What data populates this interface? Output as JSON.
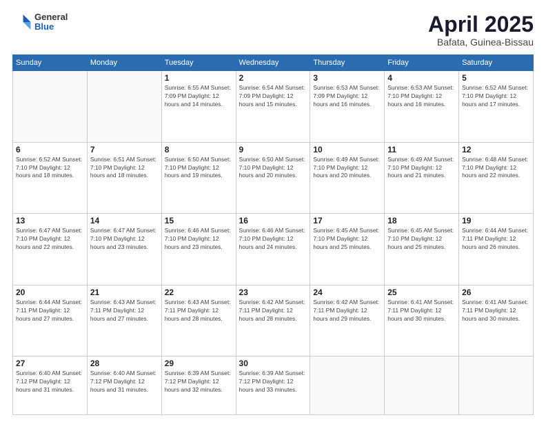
{
  "header": {
    "logo_general": "General",
    "logo_blue": "Blue",
    "month_title": "April 2025",
    "subtitle": "Bafata, Guinea-Bissau"
  },
  "weekdays": [
    "Sunday",
    "Monday",
    "Tuesday",
    "Wednesday",
    "Thursday",
    "Friday",
    "Saturday"
  ],
  "weeks": [
    [
      {
        "day": "",
        "info": ""
      },
      {
        "day": "",
        "info": ""
      },
      {
        "day": "1",
        "info": "Sunrise: 6:55 AM\nSunset: 7:09 PM\nDaylight: 12 hours and 14 minutes."
      },
      {
        "day": "2",
        "info": "Sunrise: 6:54 AM\nSunset: 7:09 PM\nDaylight: 12 hours and 15 minutes."
      },
      {
        "day": "3",
        "info": "Sunrise: 6:53 AM\nSunset: 7:09 PM\nDaylight: 12 hours and 16 minutes."
      },
      {
        "day": "4",
        "info": "Sunrise: 6:53 AM\nSunset: 7:10 PM\nDaylight: 12 hours and 16 minutes."
      },
      {
        "day": "5",
        "info": "Sunrise: 6:52 AM\nSunset: 7:10 PM\nDaylight: 12 hours and 17 minutes."
      }
    ],
    [
      {
        "day": "6",
        "info": "Sunrise: 6:52 AM\nSunset: 7:10 PM\nDaylight: 12 hours and 18 minutes."
      },
      {
        "day": "7",
        "info": "Sunrise: 6:51 AM\nSunset: 7:10 PM\nDaylight: 12 hours and 18 minutes."
      },
      {
        "day": "8",
        "info": "Sunrise: 6:50 AM\nSunset: 7:10 PM\nDaylight: 12 hours and 19 minutes."
      },
      {
        "day": "9",
        "info": "Sunrise: 6:50 AM\nSunset: 7:10 PM\nDaylight: 12 hours and 20 minutes."
      },
      {
        "day": "10",
        "info": "Sunrise: 6:49 AM\nSunset: 7:10 PM\nDaylight: 12 hours and 20 minutes."
      },
      {
        "day": "11",
        "info": "Sunrise: 6:49 AM\nSunset: 7:10 PM\nDaylight: 12 hours and 21 minutes."
      },
      {
        "day": "12",
        "info": "Sunrise: 6:48 AM\nSunset: 7:10 PM\nDaylight: 12 hours and 22 minutes."
      }
    ],
    [
      {
        "day": "13",
        "info": "Sunrise: 6:47 AM\nSunset: 7:10 PM\nDaylight: 12 hours and 22 minutes."
      },
      {
        "day": "14",
        "info": "Sunrise: 6:47 AM\nSunset: 7:10 PM\nDaylight: 12 hours and 23 minutes."
      },
      {
        "day": "15",
        "info": "Sunrise: 6:46 AM\nSunset: 7:10 PM\nDaylight: 12 hours and 23 minutes."
      },
      {
        "day": "16",
        "info": "Sunrise: 6:46 AM\nSunset: 7:10 PM\nDaylight: 12 hours and 24 minutes."
      },
      {
        "day": "17",
        "info": "Sunrise: 6:45 AM\nSunset: 7:10 PM\nDaylight: 12 hours and 25 minutes."
      },
      {
        "day": "18",
        "info": "Sunrise: 6:45 AM\nSunset: 7:10 PM\nDaylight: 12 hours and 25 minutes."
      },
      {
        "day": "19",
        "info": "Sunrise: 6:44 AM\nSunset: 7:11 PM\nDaylight: 12 hours and 26 minutes."
      }
    ],
    [
      {
        "day": "20",
        "info": "Sunrise: 6:44 AM\nSunset: 7:11 PM\nDaylight: 12 hours and 27 minutes."
      },
      {
        "day": "21",
        "info": "Sunrise: 6:43 AM\nSunset: 7:11 PM\nDaylight: 12 hours and 27 minutes."
      },
      {
        "day": "22",
        "info": "Sunrise: 6:43 AM\nSunset: 7:11 PM\nDaylight: 12 hours and 28 minutes."
      },
      {
        "day": "23",
        "info": "Sunrise: 6:42 AM\nSunset: 7:11 PM\nDaylight: 12 hours and 28 minutes."
      },
      {
        "day": "24",
        "info": "Sunrise: 6:42 AM\nSunset: 7:11 PM\nDaylight: 12 hours and 29 minutes."
      },
      {
        "day": "25",
        "info": "Sunrise: 6:41 AM\nSunset: 7:11 PM\nDaylight: 12 hours and 30 minutes."
      },
      {
        "day": "26",
        "info": "Sunrise: 6:41 AM\nSunset: 7:11 PM\nDaylight: 12 hours and 30 minutes."
      }
    ],
    [
      {
        "day": "27",
        "info": "Sunrise: 6:40 AM\nSunset: 7:12 PM\nDaylight: 12 hours and 31 minutes."
      },
      {
        "day": "28",
        "info": "Sunrise: 6:40 AM\nSunset: 7:12 PM\nDaylight: 12 hours and 31 minutes."
      },
      {
        "day": "29",
        "info": "Sunrise: 6:39 AM\nSunset: 7:12 PM\nDaylight: 12 hours and 32 minutes."
      },
      {
        "day": "30",
        "info": "Sunrise: 6:39 AM\nSunset: 7:12 PM\nDaylight: 12 hours and 33 minutes."
      },
      {
        "day": "",
        "info": ""
      },
      {
        "day": "",
        "info": ""
      },
      {
        "day": "",
        "info": ""
      }
    ]
  ]
}
